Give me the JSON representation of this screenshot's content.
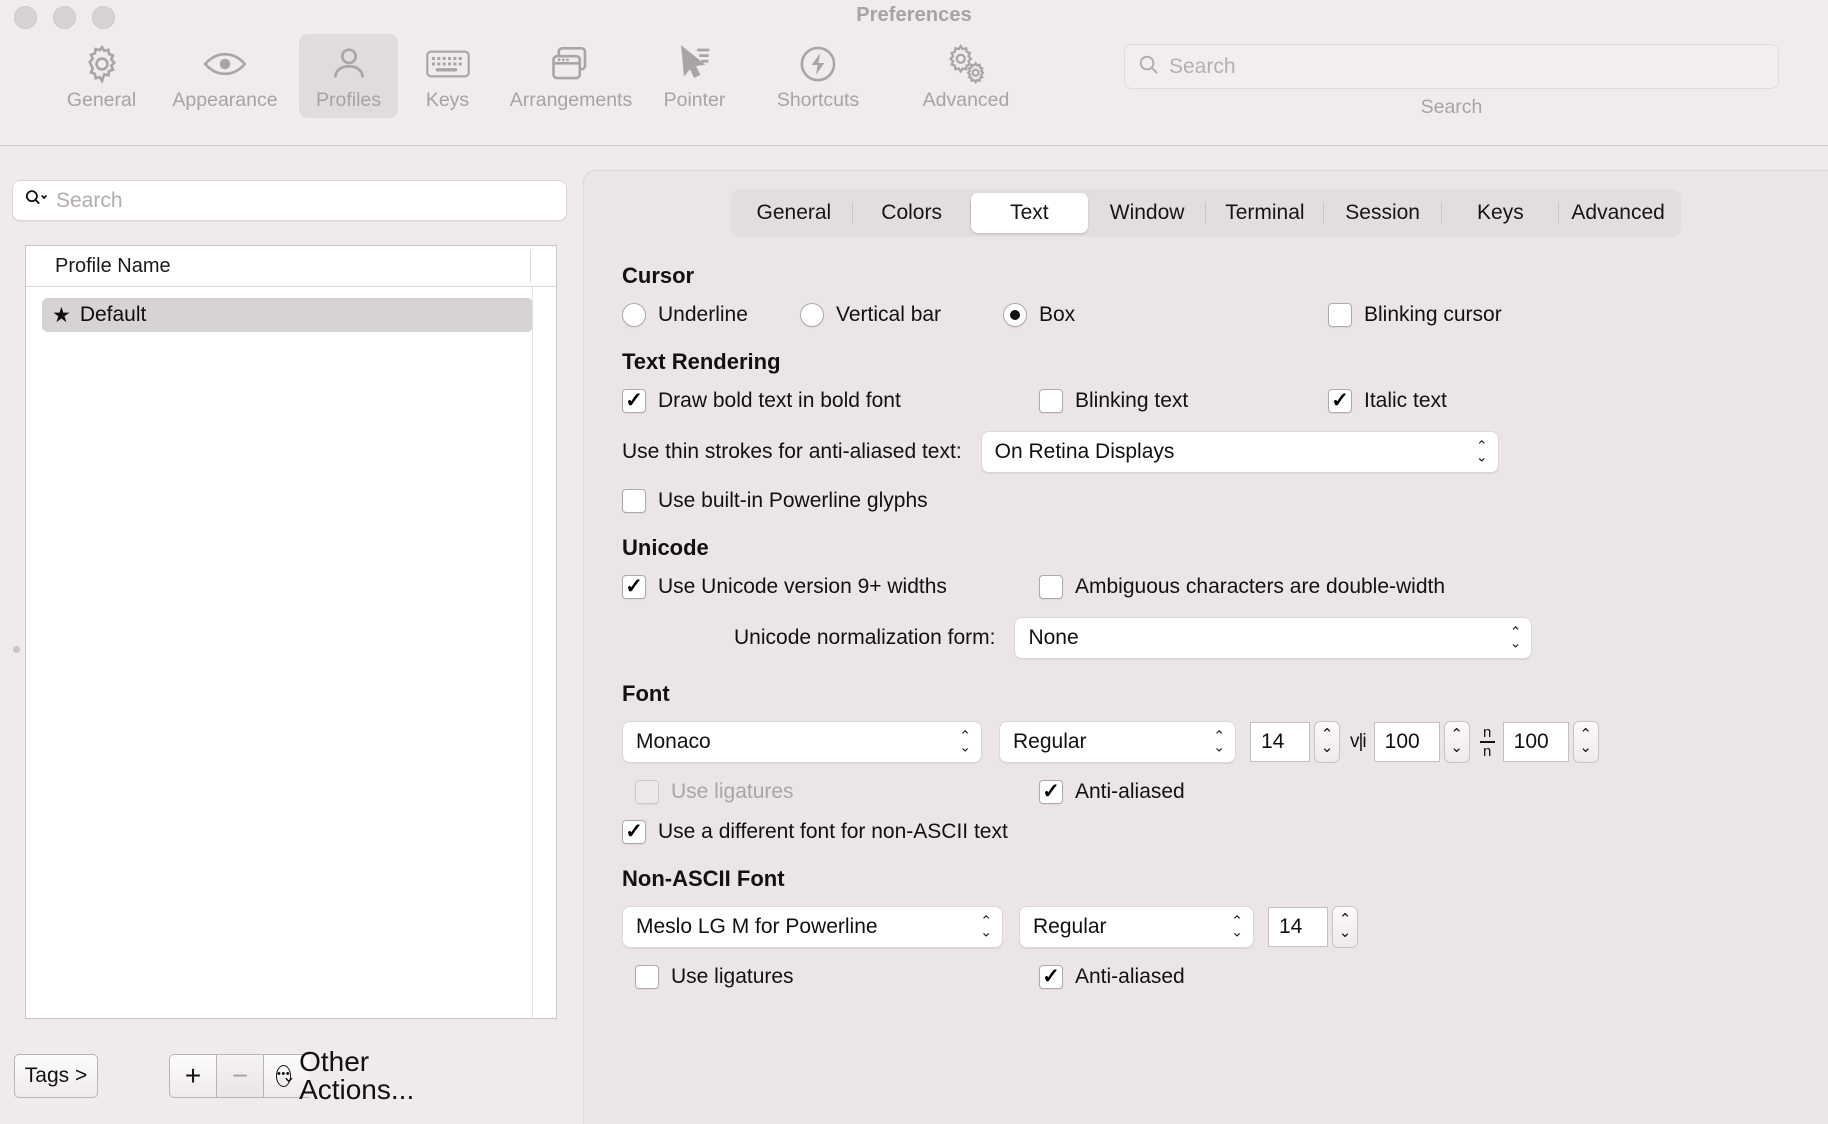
{
  "window": {
    "title": "Preferences"
  },
  "toolbar": {
    "items": [
      {
        "label": "General",
        "icon": "gear-icon",
        "selected": false
      },
      {
        "label": "Appearance",
        "icon": "eye-icon",
        "selected": false
      },
      {
        "label": "Profiles",
        "icon": "person-icon",
        "selected": true
      },
      {
        "label": "Keys",
        "icon": "keyboard-icon",
        "selected": false
      },
      {
        "label": "Arrangements",
        "icon": "windows-icon",
        "selected": false
      },
      {
        "label": "Pointer",
        "icon": "cursor-arrow-icon",
        "selected": false
      },
      {
        "label": "Shortcuts",
        "icon": "bolt-circle-icon",
        "selected": false
      },
      {
        "label": "Advanced",
        "icon": "gears-icon",
        "selected": false
      }
    ],
    "search": {
      "placeholder": "Search",
      "value": "",
      "caption": "Search",
      "icon": "search-icon"
    }
  },
  "sidebar": {
    "search": {
      "placeholder": "Search",
      "value": "",
      "icon": "search-dropdown-icon"
    },
    "table": {
      "column_header": "Profile Name",
      "rows": [
        {
          "name": "Default",
          "icon": "star-icon",
          "selected": true
        }
      ]
    },
    "footer": {
      "tags_label": "Tags >",
      "add_label": "+",
      "remove_label": "−",
      "other_actions_label": "Other Actions...",
      "other_actions_icon": "dots-circle-icon",
      "chevron_icon": "chevron-down-icon"
    }
  },
  "tabs": [
    {
      "label": "General",
      "selected": false
    },
    {
      "label": "Colors",
      "selected": false
    },
    {
      "label": "Text",
      "selected": true
    },
    {
      "label": "Window",
      "selected": false
    },
    {
      "label": "Terminal",
      "selected": false
    },
    {
      "label": "Session",
      "selected": false
    },
    {
      "label": "Keys",
      "selected": false
    },
    {
      "label": "Advanced",
      "selected": false
    }
  ],
  "cursor": {
    "title": "Cursor",
    "underline": "Underline",
    "vertical_bar": "Vertical bar",
    "box": "Box",
    "blinking_cursor": "Blinking cursor"
  },
  "text_rendering": {
    "title": "Text Rendering",
    "draw_bold": "Draw bold text in bold font",
    "blinking_text": "Blinking text",
    "italic_text": "Italic text",
    "thin_strokes_label": "Use thin strokes for anti-aliased text:",
    "thin_strokes_value": "On Retina Displays",
    "powerline_glyphs": "Use built-in Powerline glyphs"
  },
  "unicode": {
    "title": "Unicode",
    "v9_widths": "Use Unicode version 9+ widths",
    "ambiguous": "Ambiguous characters are double-width",
    "normalization_label": "Unicode normalization form:",
    "normalization_value": "None"
  },
  "font": {
    "title": "Font",
    "family": "Monaco",
    "style": "Regular",
    "size": "14",
    "horizontal_spacing": "100",
    "vertical_spacing": "100",
    "horizontal_spacing_icon": "horizontal-spacing-icon",
    "vertical_spacing_icon": "vertical-spacing-icon",
    "use_ligatures": "Use ligatures",
    "anti_aliased": "Anti-aliased",
    "different_non_ascii": "Use a different font for non-ASCII text"
  },
  "non_ascii_font": {
    "title": "Non-ASCII Font",
    "family": "Meslo LG M for Powerline",
    "style": "Regular",
    "size": "14",
    "use_ligatures": "Use ligatures",
    "anti_aliased": "Anti-aliased"
  }
}
